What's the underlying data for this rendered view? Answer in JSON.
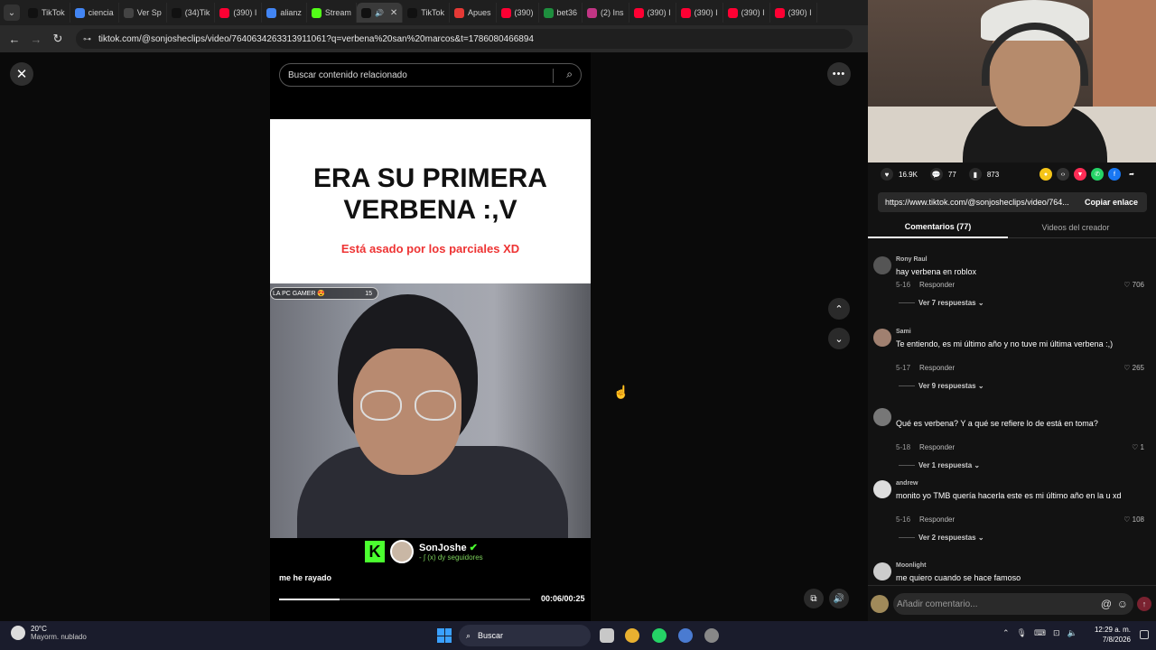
{
  "browser": {
    "tabs": [
      {
        "label": "TikTok",
        "color": "#111111",
        "active": false
      },
      {
        "label": "ciencia",
        "color": "#4285f4",
        "active": false
      },
      {
        "label": "Ver Sp",
        "color": "#444444",
        "active": false
      },
      {
        "label": "(34)Tik",
        "color": "#111111",
        "active": false
      },
      {
        "label": "(390) I",
        "color": "#ff0033",
        "active": false
      },
      {
        "label": "alianz",
        "color": "#4285f4",
        "active": false
      },
      {
        "label": "Stream",
        "color": "#53fc18",
        "active": false
      },
      {
        "label": "",
        "color": "#111111",
        "active": true
      },
      {
        "label": "TikTok",
        "color": "#111111",
        "active": false
      },
      {
        "label": "Apues",
        "color": "#e53935",
        "active": false
      },
      {
        "label": "(390)",
        "color": "#ff0033",
        "active": false
      },
      {
        "label": "bet36",
        "color": "#1e8e3e",
        "active": false
      },
      {
        "label": "(2) Ins",
        "color": "#c13584",
        "active": false
      },
      {
        "label": "(390) I",
        "color": "#ff0033",
        "active": false
      },
      {
        "label": "(390) I",
        "color": "#ff0033",
        "active": false
      },
      {
        "label": "(390) I",
        "color": "#ff0033",
        "active": false
      },
      {
        "label": "(390) I",
        "color": "#ff0033",
        "active": false
      }
    ],
    "url": "tiktok.com/@sonjosheclips/video/7640634263313911061?q=verbena%20san%20marcos&t=1786080466894"
  },
  "player": {
    "search_placeholder": "Buscar contenido relacionado",
    "video_title": "ERA SU PRIMERA\nVERBENA :,V",
    "video_subtitle": "Está asado por los parciales XD",
    "cam_tag": "LA PC GAMER 😍",
    "cam_tag_count": "15",
    "channel_name": "SonJoshe",
    "channel_followers": "- ∫ (x) dy seguidores",
    "caption": "me he rayado",
    "time": "00:06/00:25",
    "progress": 0.24
  },
  "side": {
    "likes": "16.9K",
    "comments_count": "77",
    "saves": "873",
    "link": "https://www.tiktok.com/@sonjosheclips/video/764...",
    "copy_label": "Copiar enlace",
    "tab_comments": "Comentarios (77)",
    "tab_creator": "Videos del creador",
    "reply_label": "Responder",
    "comments": [
      {
        "user": "Rony Raul",
        "text": "hay verbena en roblox",
        "date": "5-16",
        "likes": "706",
        "replies": "Ver 7 respuestas",
        "avatar": "#555555"
      },
      {
        "user": "Sami",
        "text": "Te entiendo, es mi último año y no tuve mi última verbena :,)",
        "date": "5-17",
        "likes": "265",
        "replies": "Ver 9 respuestas",
        "avatar": "#a08070"
      },
      {
        "user": "",
        "text": "Qué es verbena? Y a qué se refiere lo de está en toma?",
        "date": "5-18",
        "likes": "1",
        "replies": "Ver 1 respuesta",
        "avatar": "#777777"
      },
      {
        "user": "andrew",
        "text": "monito yo TMB quería hacerla este es mi último año en la u xd",
        "date": "5-16",
        "likes": "108",
        "replies": "Ver 2 respuestas",
        "avatar": "#dddddd"
      },
      {
        "user": "Moonlight",
        "text": "me quiero cuando se hace famoso",
        "date": "",
        "likes": "",
        "replies": "",
        "avatar": "#cccccc"
      }
    ],
    "add_comment_placeholder": "Añadir comentario..."
  },
  "taskbar": {
    "temp": "20°C",
    "weather": "Mayorm. nublado",
    "search": "Buscar",
    "time": "12:29 a. m.",
    "date": "7/8/2026"
  }
}
